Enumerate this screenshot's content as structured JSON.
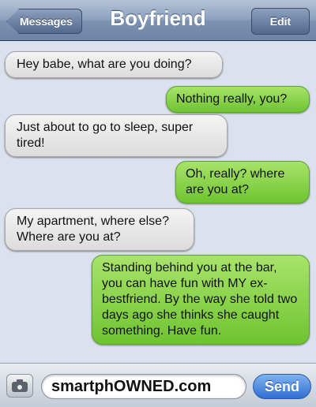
{
  "header": {
    "title": "Boyfriend",
    "back_label": "Messages",
    "edit_label": "Edit"
  },
  "messages": [
    {
      "direction": "incoming",
      "text": "Hey babe, what are you doing?"
    },
    {
      "direction": "outgoing",
      "text": "Nothing really, you?"
    },
    {
      "direction": "incoming",
      "text": "Just about to go to sleep, super tired!"
    },
    {
      "direction": "outgoing",
      "text": "Oh, really? where are you at?"
    },
    {
      "direction": "incoming",
      "text": "My apartment, where else? Where are you at?"
    },
    {
      "direction": "outgoing",
      "text": "Standing behind you at the bar, you can have fun with MY ex-bestfriend. By the way she told two days ago she thinks she caught something. Have fun."
    }
  ],
  "composer": {
    "camera_icon": "camera-icon",
    "input_value": "smartphOWNED.com",
    "send_label": "Send"
  },
  "colors": {
    "incoming_bubble": "#e6e6e6",
    "outgoing_bubble": "#7fd03f",
    "navbar": "#8da2bf",
    "background": "#dbe2ed",
    "send_button": "#3a7bd8"
  }
}
